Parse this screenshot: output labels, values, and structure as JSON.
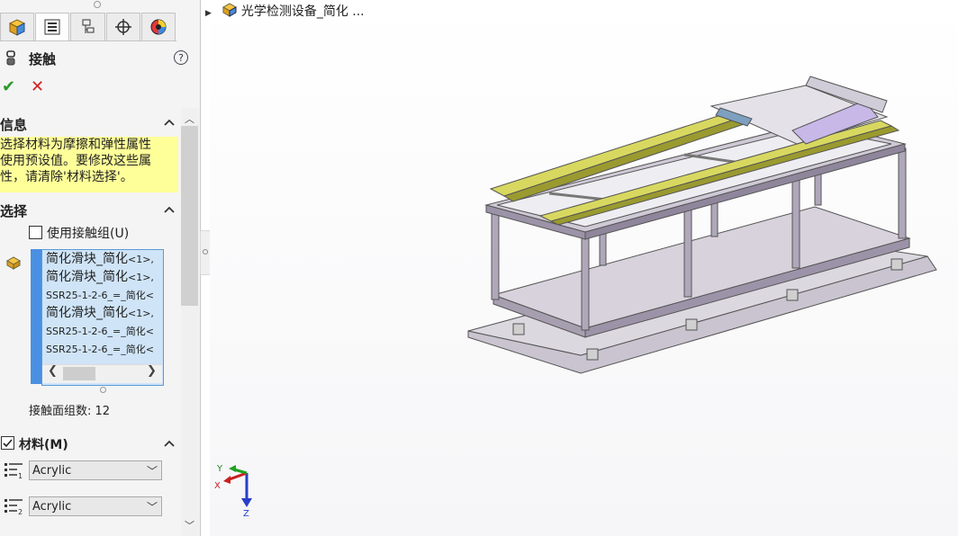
{
  "tree": {
    "root_label": "光学检测设备_简化 ..."
  },
  "tabs": [
    "feature-manager",
    "property-manager",
    "configuration-manager",
    "dimxpert-manager",
    "display-manager"
  ],
  "property_manager": {
    "title": "接触",
    "help": "?",
    "ok": "✔",
    "cancel": "✕",
    "info": {
      "header": "信息",
      "lines": [
        "选择材料为摩擦和弹性属性",
        "使用预设值。要修改这些属",
        "性，请清除'材料选择'。"
      ]
    },
    "selection": {
      "header": "选择",
      "use_group_label": "使用接触组(U)",
      "items": [
        {
          "main": "简化滑块_简化",
          "suffix": "<1>,"
        },
        {
          "main": "简化滑块_简化",
          "suffix": "<1>,"
        },
        {
          "main": "SSR25-1-2-6_=_简化",
          "suffix": "<"
        },
        {
          "main": "简化滑块_简化",
          "suffix": "<1>,"
        },
        {
          "main": "SSR25-1-2-6_=_简化",
          "suffix": "<"
        },
        {
          "main": "SSR25-1-2-6_=_简化",
          "suffix": "<"
        }
      ],
      "count_label": "接触面组数: 12"
    },
    "material": {
      "header": "材料(M)",
      "checked": true,
      "material1": "Acrylic",
      "material2": "Acrylic"
    }
  },
  "triad": {
    "x": "X",
    "y": "Y",
    "z": "Z"
  },
  "colors": {
    "accent": "#4a90e2",
    "info_bg": "#ffff99",
    "ok": "#2a9a2a",
    "cancel": "#d42020",
    "frame": "#9c93a8",
    "rail": "#d8d860"
  }
}
